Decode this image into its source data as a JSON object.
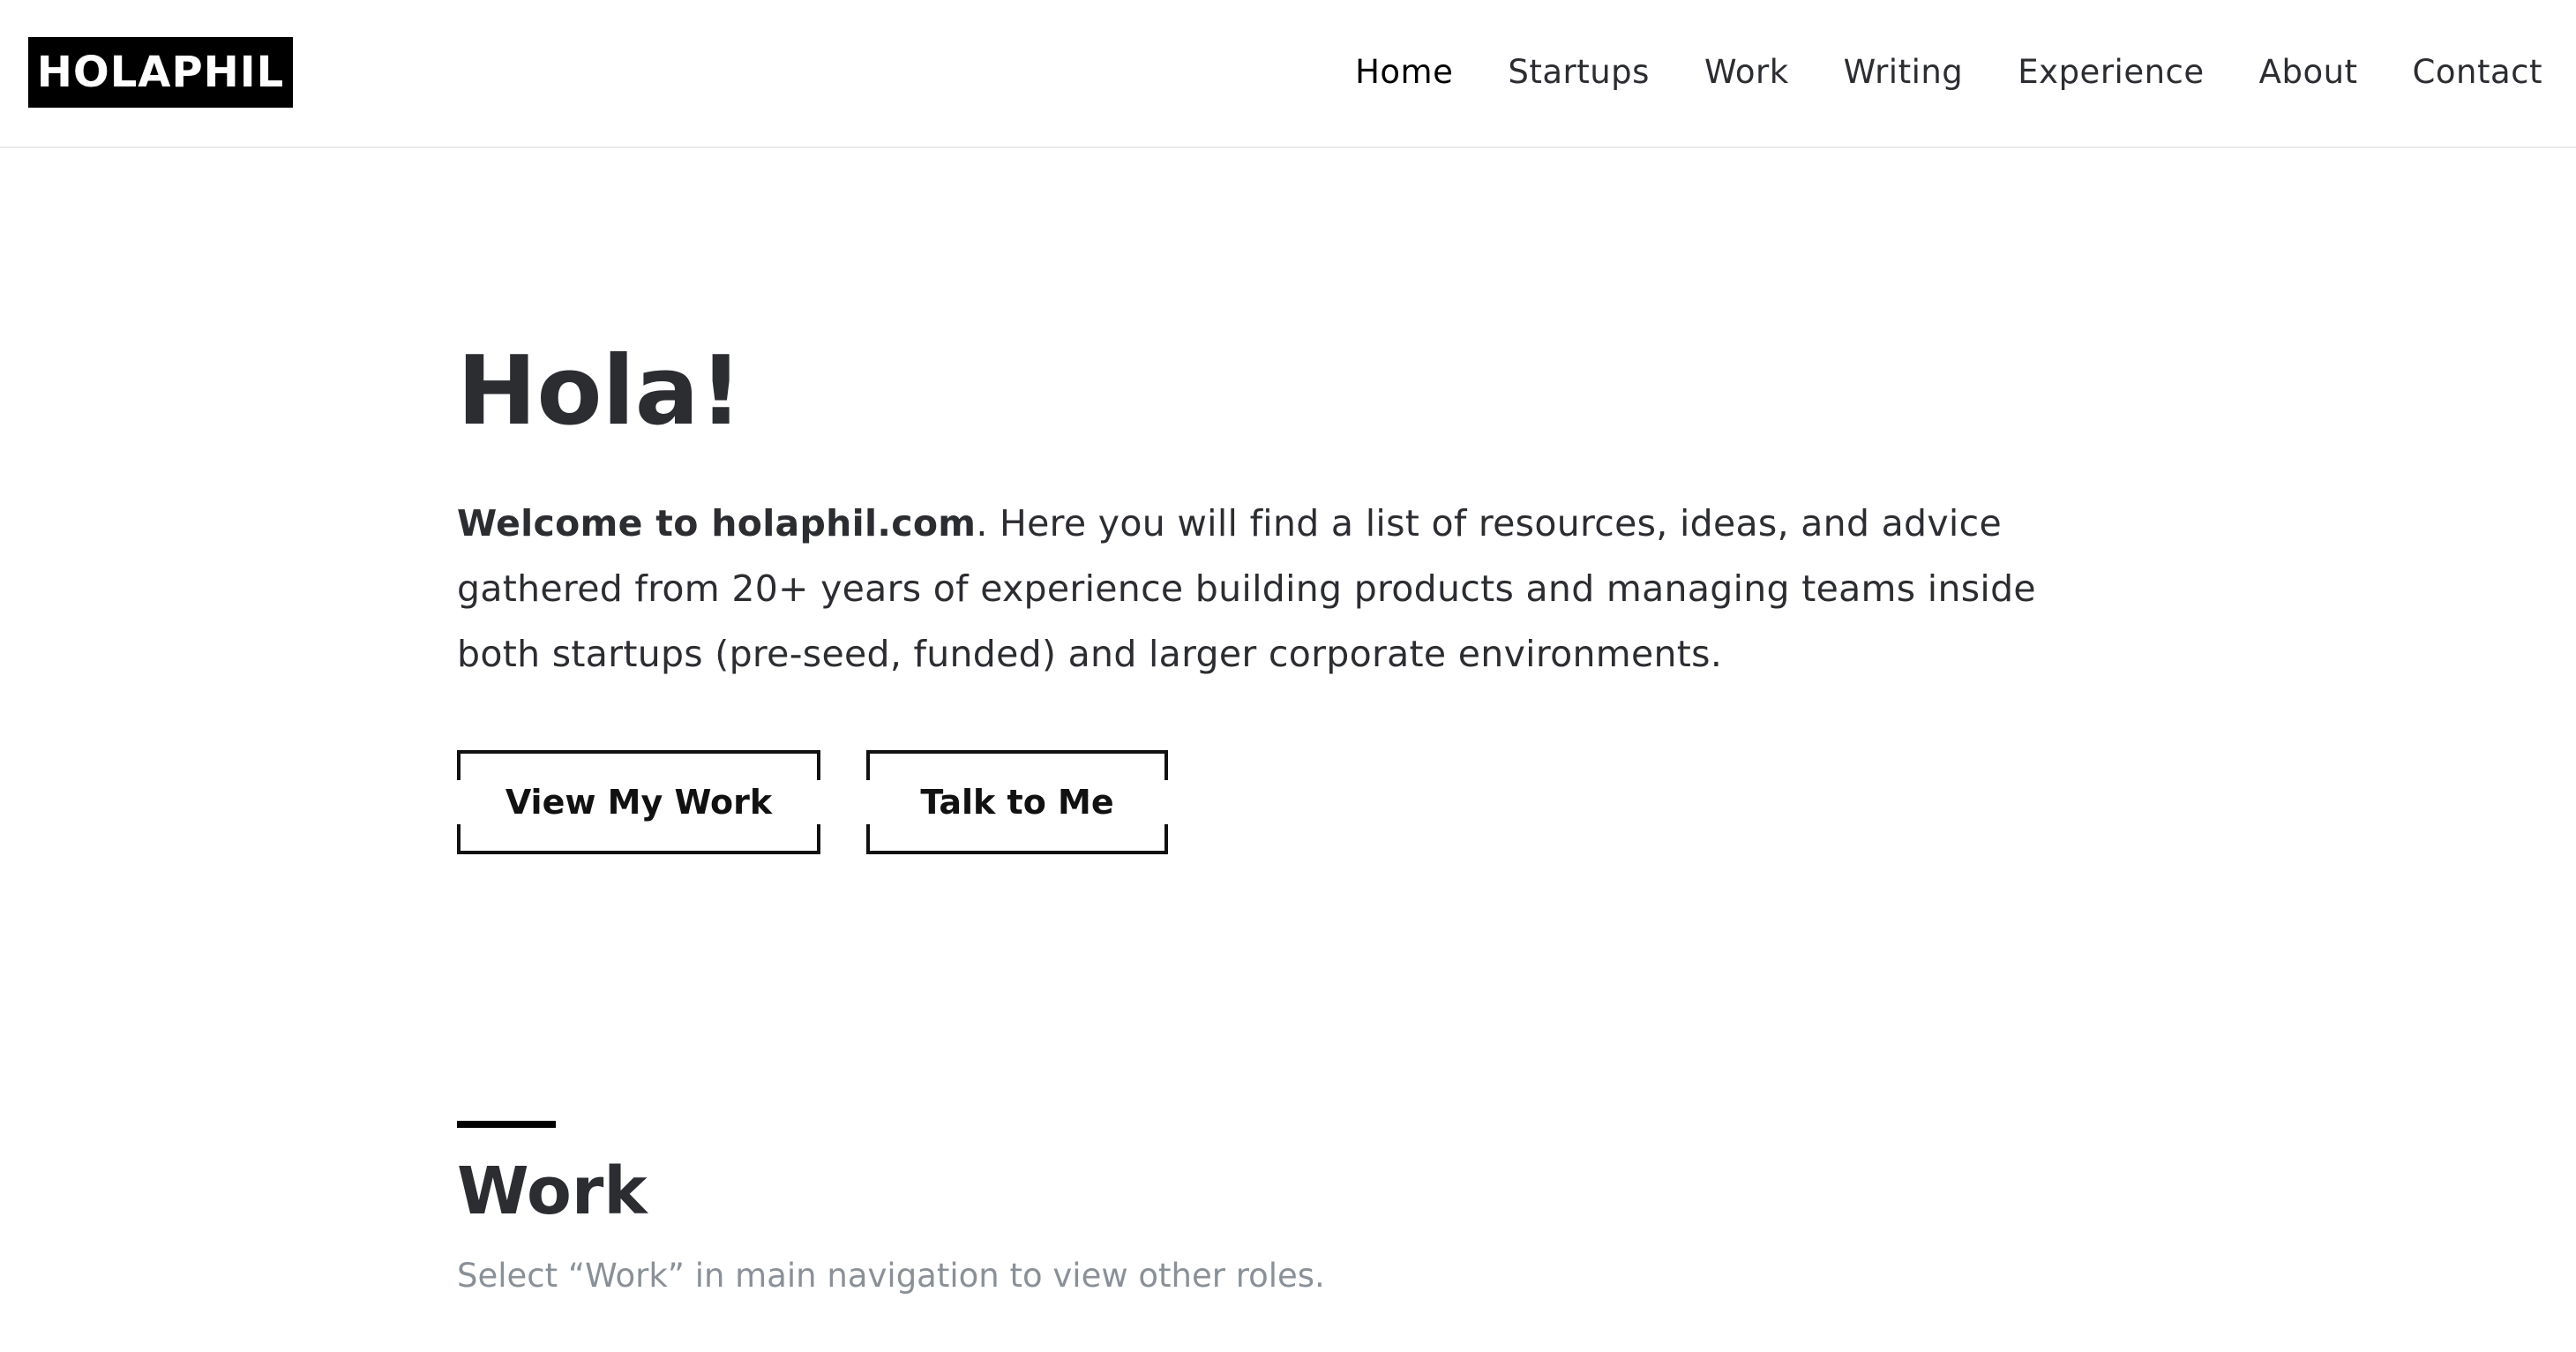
{
  "site": {
    "logo_text": "HOLAPHIL"
  },
  "nav": {
    "items": [
      {
        "label": "Home",
        "active": true
      },
      {
        "label": "Startups",
        "active": false
      },
      {
        "label": "Work",
        "active": false
      },
      {
        "label": "Writing",
        "active": false
      },
      {
        "label": "Experience",
        "active": false
      },
      {
        "label": "About",
        "active": false
      },
      {
        "label": "Contact",
        "active": false
      }
    ]
  },
  "hero": {
    "title": "Hola!",
    "intro_bold": "Welcome to holaphil.com",
    "intro_rest": ". Here you will find a list of resources, ideas, and advice gathered from 20+ years of experience building products and managing teams inside both startups (pre-seed, funded) and larger corporate environments.",
    "buttons": {
      "primary": "View My Work",
      "secondary": "Talk to Me"
    }
  },
  "work_section": {
    "title": "Work",
    "subtitle": "Select “Work” in main navigation to view other roles."
  },
  "colors": {
    "text": "#2b2d31",
    "muted": "#8a9097",
    "accent": "#000000",
    "background": "#ffffff"
  }
}
